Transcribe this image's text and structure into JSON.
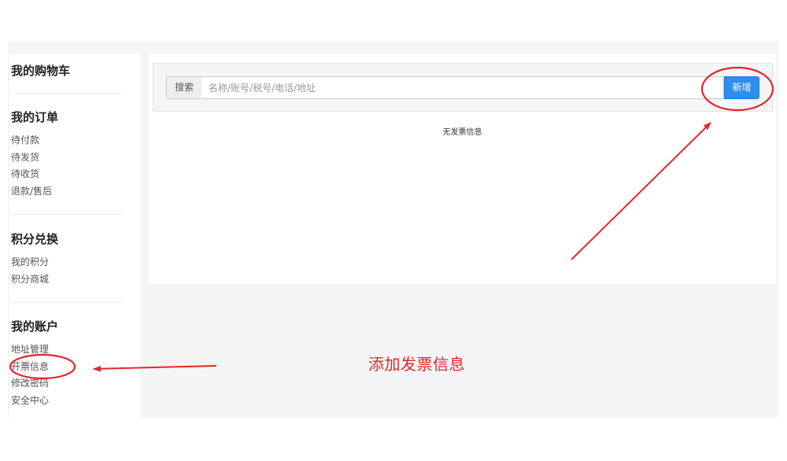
{
  "sidebar": {
    "groups": [
      {
        "title": "我的购物车",
        "items": []
      },
      {
        "title": "我的订单",
        "items": [
          "待付款",
          "待发货",
          "待收货",
          "退款/售后"
        ]
      },
      {
        "title": "积分兑换",
        "items": [
          "我的积分",
          "积分商城"
        ]
      },
      {
        "title": "我的账户",
        "items": [
          "地址管理",
          "开票信息",
          "修改密码",
          "安全中心"
        ]
      }
    ]
  },
  "search": {
    "label": "搜索",
    "placeholder": "名称/账号/税号/电话/地址",
    "value": ""
  },
  "toolbar": {
    "add_label": "新增"
  },
  "main": {
    "empty_message": "无发票信息"
  },
  "annotation": {
    "text": "添加发票信息",
    "color": "#e3262c"
  },
  "colors": {
    "accent": "#2f8def",
    "annotation_red": "#e3262c"
  }
}
